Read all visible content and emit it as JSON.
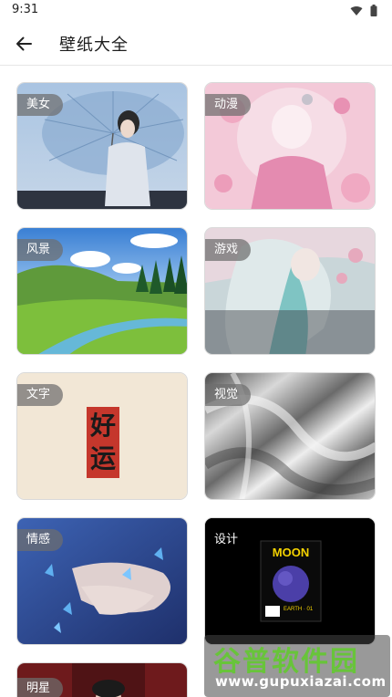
{
  "status": {
    "time": "9:31"
  },
  "header": {
    "title": "壁纸大全"
  },
  "categories": [
    {
      "label": "美女"
    },
    {
      "label": "动漫"
    },
    {
      "label": "风景"
    },
    {
      "label": "游戏"
    },
    {
      "label": "文字"
    },
    {
      "label": "视觉"
    },
    {
      "label": "情感"
    },
    {
      "label": "设计"
    },
    {
      "label": "明星"
    }
  ],
  "card_texts": {
    "calligraphy": "好运",
    "poster_title": "MOON",
    "poster_subtitle": "EARTH · 01"
  },
  "watermark": {
    "title": "谷普软件园",
    "url": "www.gupuxiazai.com"
  }
}
